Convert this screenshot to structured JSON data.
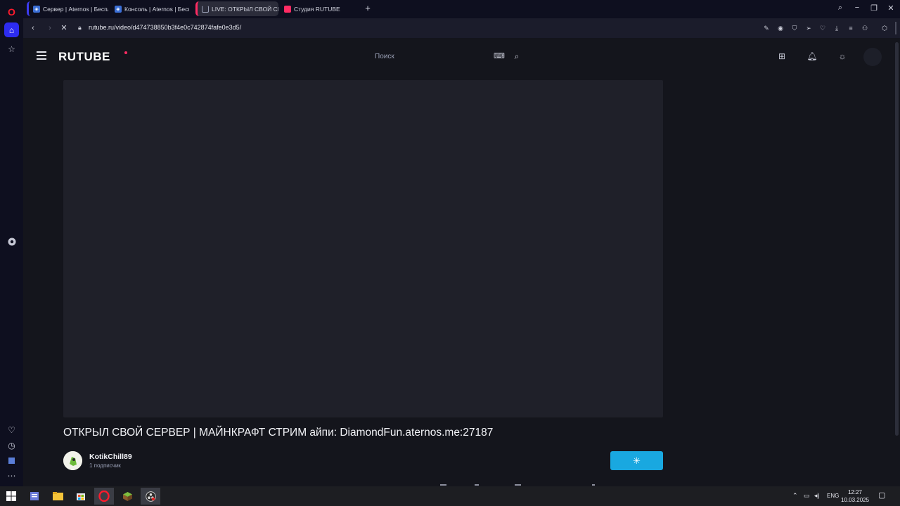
{
  "browser": {
    "tabs": [
      {
        "title": "Сервер | Aternos | Беспл",
        "favicon": "aternos-icon",
        "active": false
      },
      {
        "title": "Консоль | Aternos | Беспл",
        "favicon": "aternos-icon",
        "active": false
      },
      {
        "title": "LIVE: ОТКРЫЛ СВОЙ СЕР",
        "favicon": "loading-spinner-icon",
        "active": true
      },
      {
        "title": "Студия RUTUBE",
        "favicon": "rutube-icon",
        "active": false
      }
    ],
    "url": "rutube.ru/video/d474738850b3f4e0c742874fafe0e3d5/",
    "accent": "#2d2cf0"
  },
  "site": {
    "logo": "RUTUBE",
    "search_placeholder": "Поиск",
    "accent": "#ff2b63"
  },
  "video": {
    "title": "ОТКРЫЛ СВОЙ СЕРВЕР | МАЙНКРАФТ СТРИМ айпи: DiamondFun.aternos.me:27187",
    "channel_name": "KotikChill89",
    "subscribers": "1 подписчик",
    "subscribe_color": "#19a8e0"
  },
  "taskbar": {
    "lang": "ENG",
    "time": "12:27",
    "date": "10.03.2025"
  }
}
